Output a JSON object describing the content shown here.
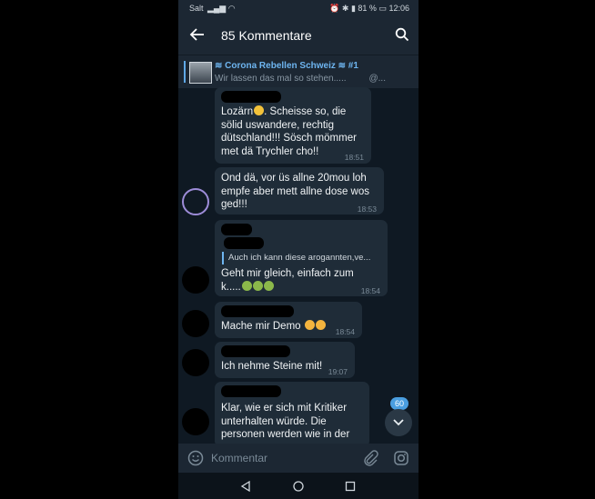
{
  "status_bar": {
    "carrier": "Salt",
    "battery": "81 %",
    "time": "12:06"
  },
  "header": {
    "title": "85 Kommentare"
  },
  "pinned": {
    "channel": "≋ Corona Rebellen Schweiz ≋ #1",
    "preview": "Wir lassen das mal so stehen.....",
    "suffix": "@..."
  },
  "messages": [
    {
      "text": "Lozärn",
      "text_after": ". Scheisse so, die\nsölid uswandere, rechtig\ndütschland!!! Sösch mömmer\nmet dä Trychler cho!!",
      "time": "18:51"
    },
    {
      "text": "Ond dä, vor üs allne 20mou loh\nempfe aber mett allne dose wos\nged!!!",
      "time": "18:53"
    },
    {
      "reply": "Auch ich kann diese arogannten,ve...",
      "text": "Geht mir gleich, einfach zum\nk.....",
      "time": "18:54"
    },
    {
      "text": "Mache mir Demo",
      "time": "18:54"
    },
    {
      "text": "Ich nehme Steine mit!",
      "time": "19:07"
    },
    {
      "text": "Klar, wie er sich mit Kritiker\nunterhalten würde. Die\npersonen werden wie in der",
      "time": ""
    }
  ],
  "scroll_badge": "60",
  "input": {
    "placeholder": "Kommentar"
  },
  "colors": {
    "accent": "#5fa8e6",
    "bubble": "#1f2c38",
    "background": "#0f1923"
  }
}
